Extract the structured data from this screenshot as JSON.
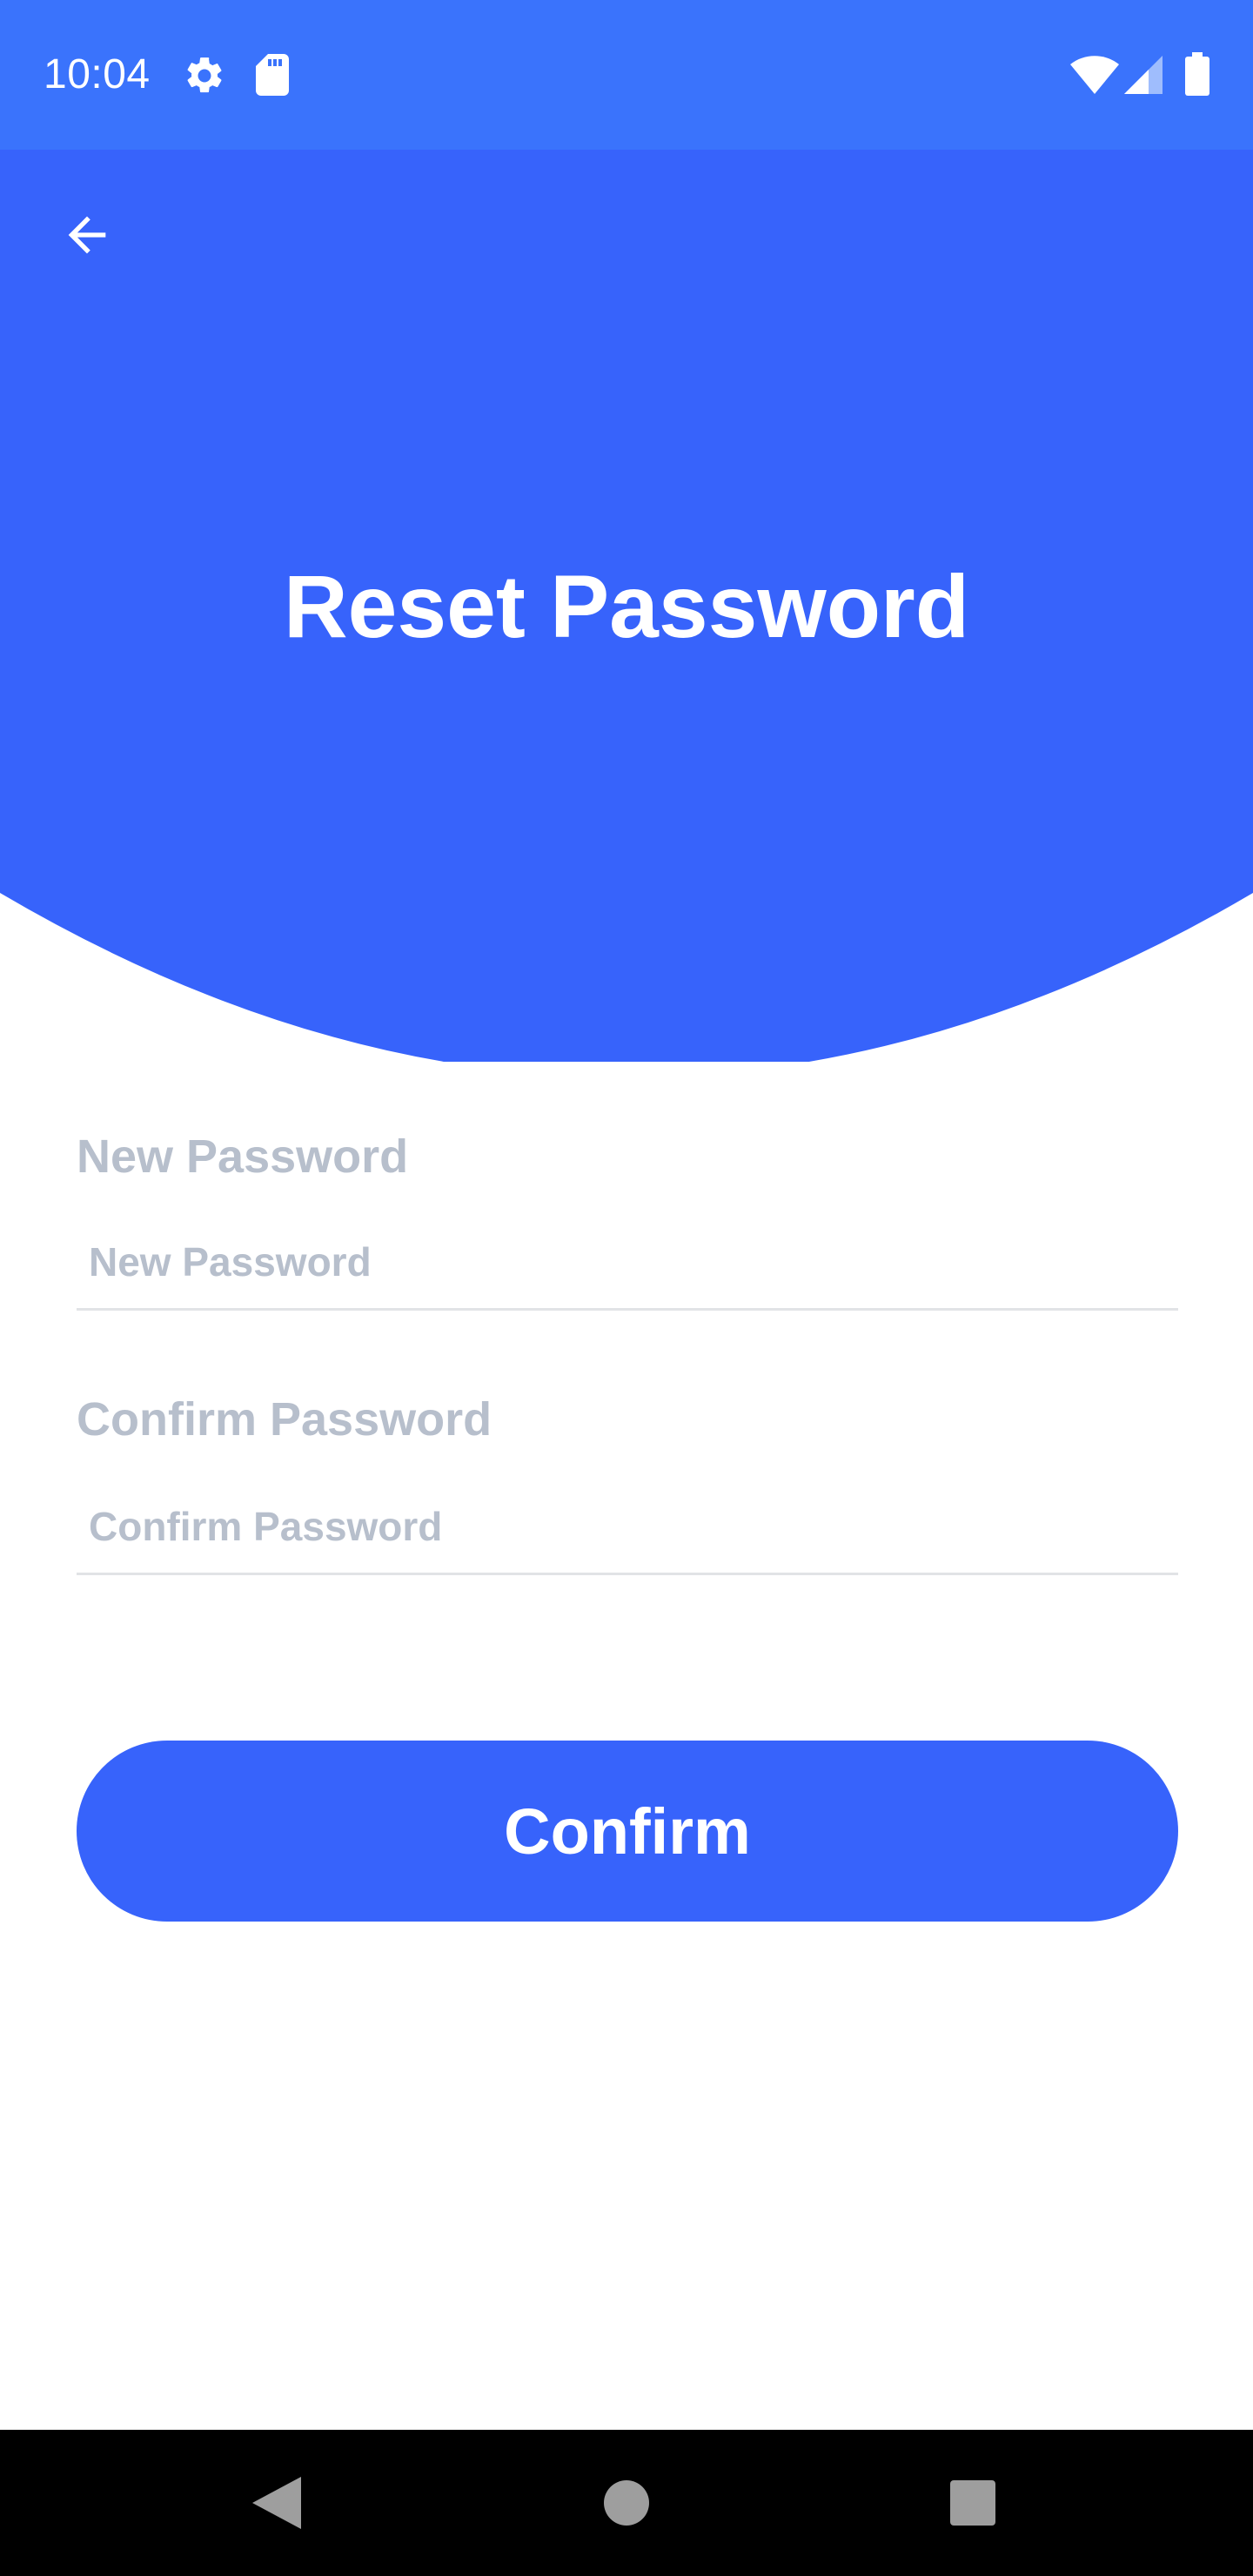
{
  "status_bar": {
    "time": "10:04",
    "icons": [
      "gear-icon",
      "sd-card-icon",
      "wifi-icon",
      "cell-signal-icon",
      "battery-icon"
    ],
    "background": "#3a73fc"
  },
  "header": {
    "title": "Reset Password",
    "back_icon": "arrow-left-icon",
    "background": "#3763fb"
  },
  "form": {
    "new_password": {
      "label": "New Password",
      "placeholder": "New Password",
      "value": ""
    },
    "confirm_password": {
      "label": "Confirm Password",
      "placeholder": "Confirm Password",
      "value": ""
    },
    "label_color": "#b7bfcc"
  },
  "actions": {
    "confirm_label": "Confirm",
    "accent": "#3763fb"
  },
  "nav_bar": {
    "icons": [
      "nav-back-icon",
      "nav-home-icon",
      "nav-recents-icon"
    ],
    "background": "#000000"
  }
}
